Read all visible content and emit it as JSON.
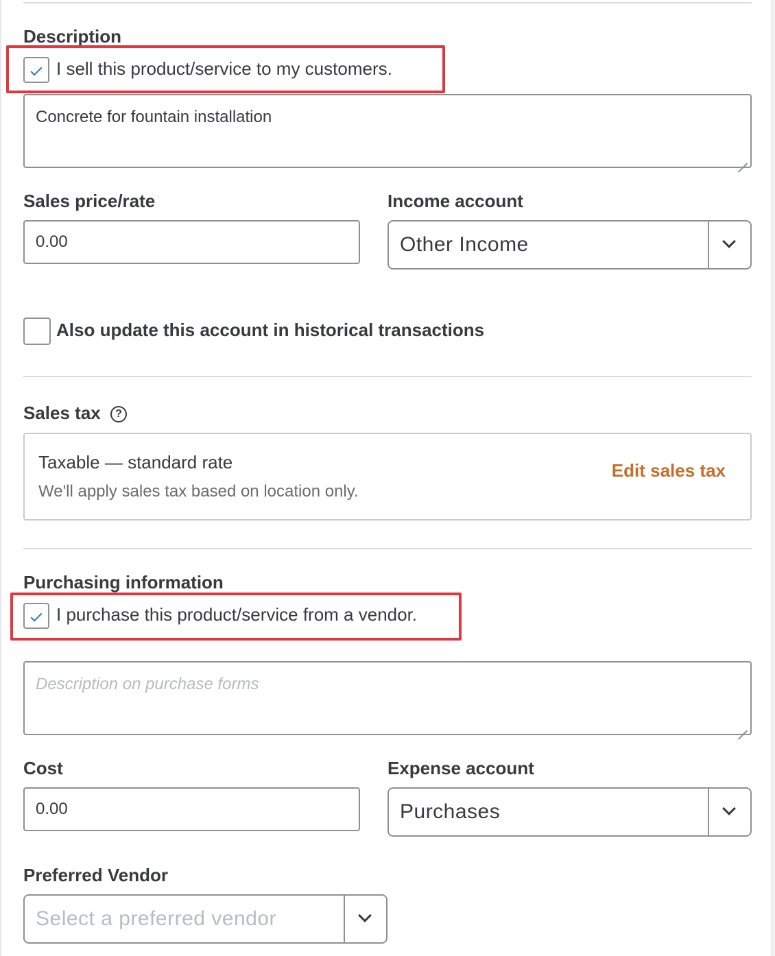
{
  "description": {
    "label": "Description",
    "sell_checkbox": {
      "checked": true,
      "label": "I sell this product/service to my customers."
    },
    "text": "Concrete for fountain installation"
  },
  "sales_price": {
    "label": "Sales price/rate",
    "value": "0.00"
  },
  "income_account": {
    "label": "Income account",
    "value": "Other Income"
  },
  "historical_checkbox": {
    "checked": false,
    "label": "Also update this account in historical transactions"
  },
  "sales_tax": {
    "label": "Sales tax",
    "help_icon": "question-circle-icon",
    "title": "Taxable — standard rate",
    "subtitle": "We'll apply sales tax based on location only.",
    "edit_link": "Edit sales tax"
  },
  "purchasing": {
    "label": "Purchasing information",
    "purchase_checkbox": {
      "checked": true,
      "label": "I purchase this product/service from a vendor."
    },
    "description_placeholder": "Description on purchase forms"
  },
  "cost": {
    "label": "Cost",
    "value": "0.00"
  },
  "expense_account": {
    "label": "Expense account",
    "value": "Purchases"
  },
  "preferred_vendor": {
    "label": "Preferred Vendor",
    "placeholder": "Select a preferred vendor"
  },
  "colors": {
    "highlight": "#e0383e",
    "link": "#c46f2b",
    "check": "#3271c4"
  }
}
